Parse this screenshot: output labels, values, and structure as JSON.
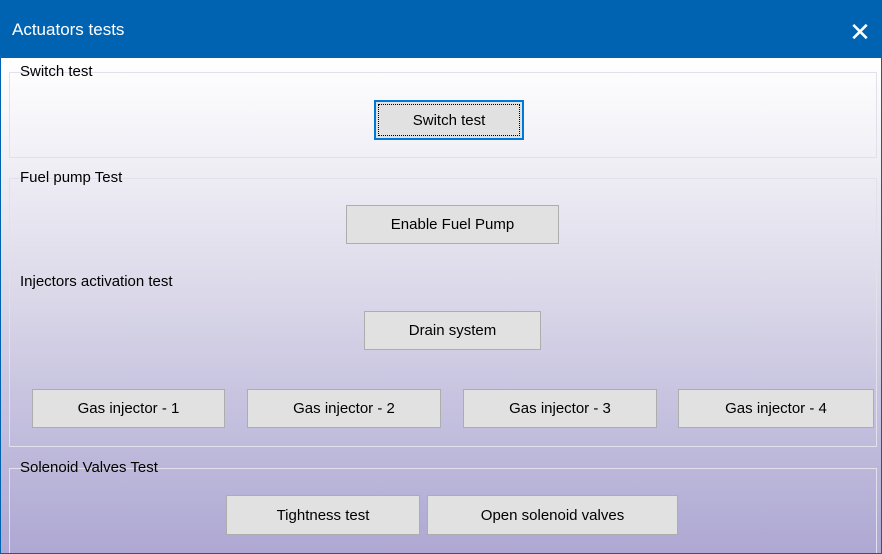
{
  "window": {
    "title": "Actuators tests",
    "close_glyph": "✕"
  },
  "switch_test": {
    "group_label": "Switch test",
    "button_label": "Switch test"
  },
  "fuel_pump": {
    "group_label": "Fuel pump Test",
    "enable_button": "Enable Fuel Pump",
    "injectors_label": "Injectors activation test",
    "drain_button": "Drain system",
    "injectors": [
      "Gas injector - 1",
      "Gas injector - 2",
      "Gas injector - 3",
      "Gas injector - 4"
    ]
  },
  "solenoid": {
    "group_label": "Solenoid Valves Test",
    "tightness_button": "Tightness test",
    "open_button": "Open solenoid valves"
  },
  "colors": {
    "titlebar": "#0063b1",
    "button_face": "#e1e1e1",
    "focus_border": "#0078d7"
  }
}
